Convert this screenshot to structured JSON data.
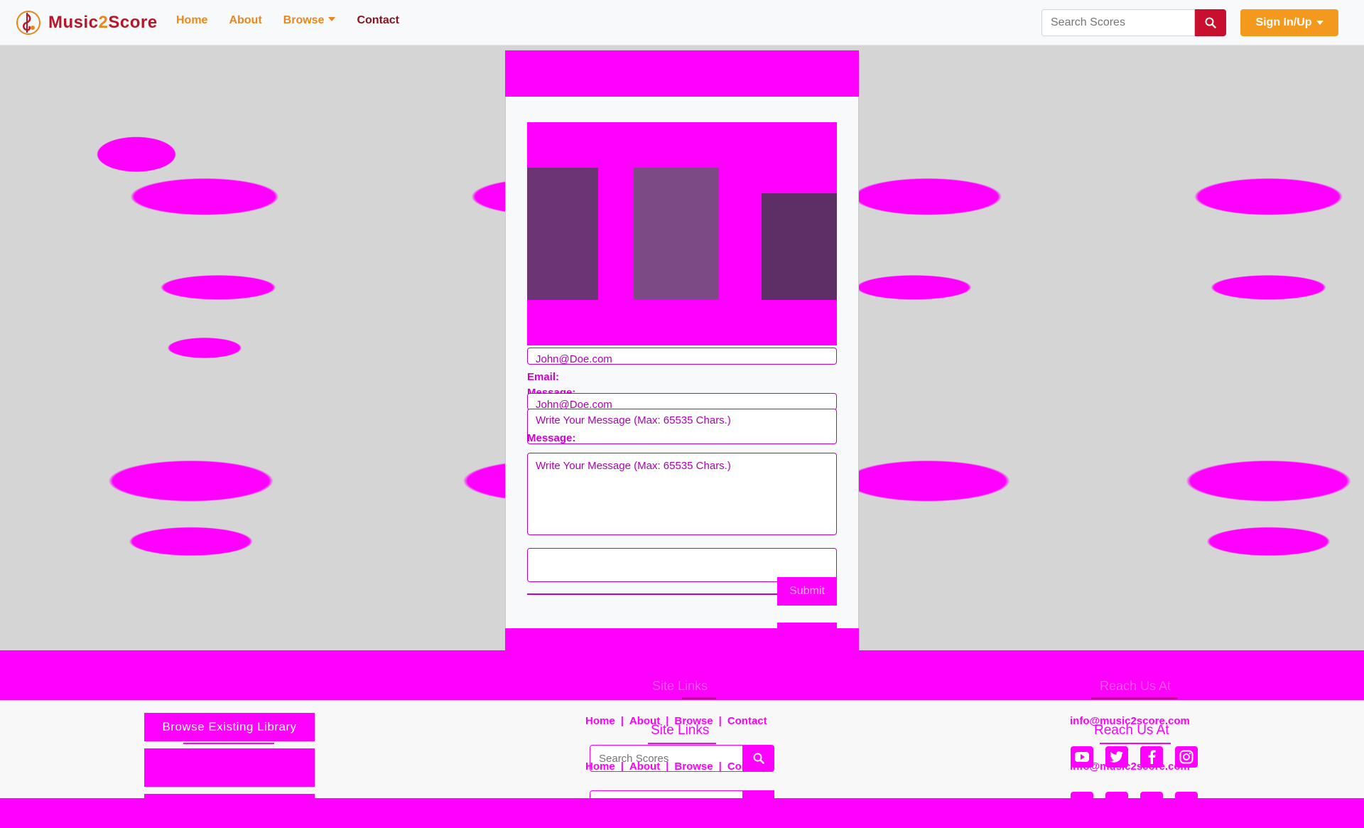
{
  "navbar": {
    "brand_prefix": "Music",
    "brand_two": "2",
    "brand_suffix": "Score",
    "links": [
      "Home",
      "About",
      "Browse",
      "Contact"
    ],
    "search_placeholder": "Search Scores",
    "signin_label": "Sign In/Up"
  },
  "contact": {
    "email_value": "John@Doe.com",
    "email_label": "Email:",
    "message_label": "Message:",
    "message_placeholder": "Write Your Message (Max: 65535 Chars.)",
    "submit_label": "Submit"
  },
  "footer": {
    "browse_button": "Browse Existing Library",
    "site_links_heading": "Site Links",
    "links": [
      "Home",
      "About",
      "Browse",
      "Contact"
    ],
    "search_placeholder": "Search Scores",
    "reach_heading": "Reach Us At",
    "email": "info@music2score.com",
    "social_icons": [
      "youtube-icon",
      "twitter-icon",
      "facebook-icon",
      "instagram-icon"
    ]
  },
  "colors": {
    "brand_red": "#b5172a",
    "brand_orange": "#e8871e",
    "accent_magenta": "#ff00ff",
    "search_button": "#c8102e",
    "signin_button": "#f39a1e"
  }
}
